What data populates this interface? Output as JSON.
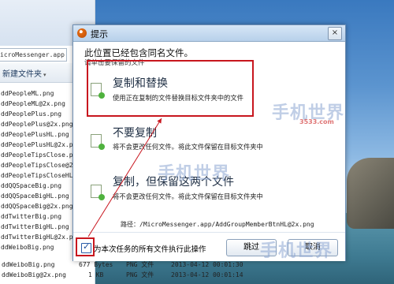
{
  "background": {
    "path_text": "icroMessenger.app",
    "new_folder_label": "新建文件夹",
    "files": [
      "ddPeopleML.png",
      "ddPeopleML@2x.png",
      "ddPeoplePlus.png",
      "ddPeoplePlus@2x.png",
      "ddPeoplePlusHL.png",
      "ddPeoplePlusHL@2x.png",
      "ddPeopleTipsClose.png",
      "ddPeopleTipsClose@2x.png",
      "ddPeopleTipsCloseHL.p",
      "ddQQSpaceBig.png",
      "ddQQSpaceBigHL.png",
      "ddQQSpaceBig@2x.png",
      "ddTwitterBig.png",
      "ddTwitterBigHL.png",
      "ddTwitterBigHL@2x.png",
      "ddWeiboBig.png"
    ],
    "info_rows": [
      {
        "name": "ddWeiboBig.png",
        "size": "677 Bytes",
        "type": "PNG 文件",
        "date": "2013-04-12 00:01:30"
      },
      {
        "name": "ddWeiboBig@2x.png",
        "size": "1 KB",
        "type": "PNG 文件",
        "date": "2013-04-12 00:01:14"
      }
    ],
    "info_row_top": {
      "size": "2 KB",
      "type": "PNG 文件",
      "date": "2013-04-12 00:01:30"
    }
  },
  "dialog": {
    "title": "提示",
    "close_label": "×",
    "heading": "此位置已经包含同名文件。",
    "subheading": "请单击要保留的文件",
    "options": [
      {
        "title": "复制和替换",
        "desc": "使用正在复制的文件替换目标文件夹中的文件"
      },
      {
        "title": "不要复制",
        "desc": "将不会更改任何文件。将此文件保留在目标文件夹中"
      },
      {
        "title": "复制，但保留这两个文件",
        "desc": "将不会更改任何文件。将此文件保留在目标文件夹中"
      }
    ],
    "path_label": "路径：/MicroMessenger.app/AddGroupMemberBtnHL@2x.png",
    "checkbox_label": "为本次任务的所有文件执行此操作",
    "checkbox_checked": true,
    "skip_button": "跳过",
    "cancel_button": "取消"
  },
  "watermark": {
    "text": "手机世界",
    "sub": "3533.com"
  },
  "colors": {
    "highlight": "#c8161e",
    "accent": "#2a5da8"
  }
}
